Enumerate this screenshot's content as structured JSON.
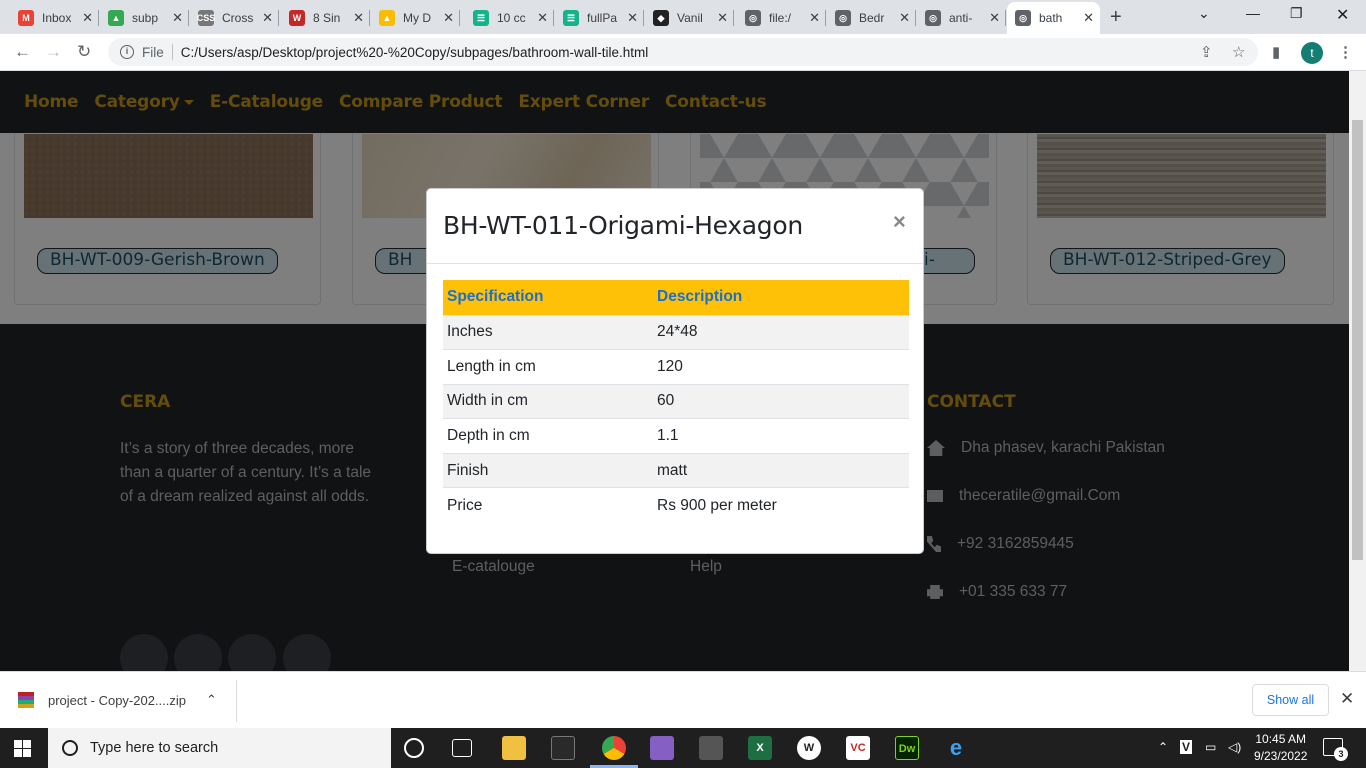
{
  "browser": {
    "tabs": [
      {
        "label": "Inbox",
        "icon": "gmail-icon",
        "color": "#ea4335",
        "glyph": "M"
      },
      {
        "label": "subp",
        "icon": "google-drive-icon",
        "color": "#34a853",
        "glyph": "▲"
      },
      {
        "label": "Cross",
        "icon": "css3-icon",
        "color": "#777777",
        "glyph": "CSS"
      },
      {
        "label": "8 Sin",
        "icon": "webflow-icon",
        "color": "#c62828",
        "glyph": "W"
      },
      {
        "label": "My D",
        "icon": "google-drive-icon",
        "color": "#fbbc04",
        "glyph": "▲"
      },
      {
        "label": "10 cc",
        "icon": "template-icon",
        "color": "#13b38b",
        "glyph": "☰"
      },
      {
        "label": "fullPa",
        "icon": "template-icon",
        "color": "#13b38b",
        "glyph": "☰"
      },
      {
        "label": "Vanil",
        "icon": "codepen-icon",
        "color": "#222222",
        "glyph": "◆"
      },
      {
        "label": "file:/",
        "icon": "globe-icon",
        "color": "#5f6368",
        "glyph": "◎"
      },
      {
        "label": "Bedr",
        "icon": "globe-icon",
        "color": "#5f6368",
        "glyph": "◎"
      },
      {
        "label": "anti-",
        "icon": "globe-icon",
        "color": "#5f6368",
        "glyph": "◎"
      },
      {
        "label": "bath",
        "icon": "globe-icon",
        "color": "#5f6368",
        "glyph": "◎"
      }
    ],
    "address": {
      "scheme_label": "File",
      "url": "C:/Users/asp/Desktop/project%20-%20Copy/subpages/bathroom-wall-tile.html"
    },
    "profile_initial": "t"
  },
  "site": {
    "nav": {
      "home": "Home",
      "category": "Category",
      "ecatalogue": "E-Catalouge",
      "compare": "Compare Product",
      "expert": "Expert Corner",
      "contact": "Contact-us"
    },
    "products": [
      {
        "name": "BH-WT-009-Gerish-Brown"
      },
      {
        "name": "BH"
      },
      {
        "name": "i-"
      },
      {
        "name": "BH-WT-012-Striped-Grey"
      }
    ],
    "footer": {
      "brand_title": "CERA",
      "about": "It’s a story of three decades, more than a quarter of a century. It’s a tale of a dream realized against all odds.",
      "contact_title": "CONTACT",
      "link1": "E-catalouge",
      "link2": "Help",
      "address": "Dha phasev, karachi Pakistan",
      "email": "theceratile@gmail.Com",
      "phone": "+92 3162859445",
      "fax": "+01 335 633 77"
    }
  },
  "modal": {
    "title": "BH-WT-011-Origami-Hexagon",
    "close_glyph": "×",
    "headers": [
      "Specification",
      "Description"
    ],
    "rows": [
      [
        "Inches",
        "24*48"
      ],
      [
        "Length in cm",
        "120"
      ],
      [
        "Width in cm",
        "60"
      ],
      [
        "Depth in cm",
        "1.1"
      ],
      [
        "Finish",
        "matt"
      ],
      [
        "Price",
        "Rs 900 per meter"
      ]
    ]
  },
  "downloads": {
    "file": "project - Copy-202....zip",
    "show_all": "Show all"
  },
  "taskbar": {
    "search_placeholder": "Type here to search",
    "time": "10:45 AM",
    "date": "9/23/2022",
    "notifications": "3"
  },
  "colors": {
    "nav_bg": "#212529",
    "nav_link": "#c99a16",
    "table_header_bg": "#ffc107",
    "table_header_text": "#1a6fd0"
  }
}
